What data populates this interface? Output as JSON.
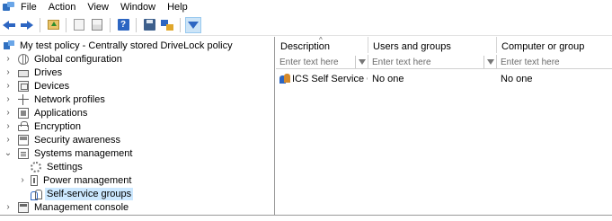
{
  "menu": {
    "items": [
      "File",
      "Action",
      "View",
      "Window",
      "Help"
    ]
  },
  "toolbar": {
    "buttons": [
      "back-icon",
      "forward-icon",
      "up-folder-icon",
      "show-hide-tree-icon",
      "export-list-icon",
      "help-icon",
      "save-icon",
      "network-icon",
      "filter-icon"
    ]
  },
  "tree": {
    "root": "My test policy - Centrally stored DriveLock policy",
    "items": [
      {
        "label": "Global configuration",
        "icon": "globe-icon"
      },
      {
        "label": "Drives",
        "icon": "drive-icon"
      },
      {
        "label": "Devices",
        "icon": "devices-icon"
      },
      {
        "label": "Network profiles",
        "icon": "network-icon"
      },
      {
        "label": "Applications",
        "icon": "applications-icon"
      },
      {
        "label": "Encryption",
        "icon": "lock-icon"
      },
      {
        "label": "Security awareness",
        "icon": "security-icon"
      },
      {
        "label": "Systems management",
        "icon": "systems-management-icon"
      },
      {
        "label": "Settings",
        "icon": "gear-icon"
      },
      {
        "label": "Power management",
        "icon": "power-icon"
      },
      {
        "label": "Self-service groups",
        "icon": "group-icon",
        "selected": true
      },
      {
        "label": "Management console",
        "icon": "console-icon"
      }
    ]
  },
  "grid": {
    "columns": [
      "Description",
      "Users and groups",
      "Computer or group"
    ],
    "filter_placeholder": "Enter text here",
    "rows": [
      {
        "description": "ICS Self Service G...",
        "users": "No one",
        "computers": "No one"
      }
    ]
  },
  "colors": {
    "selection": "#cce8ff",
    "accent": "#2d66c2"
  }
}
